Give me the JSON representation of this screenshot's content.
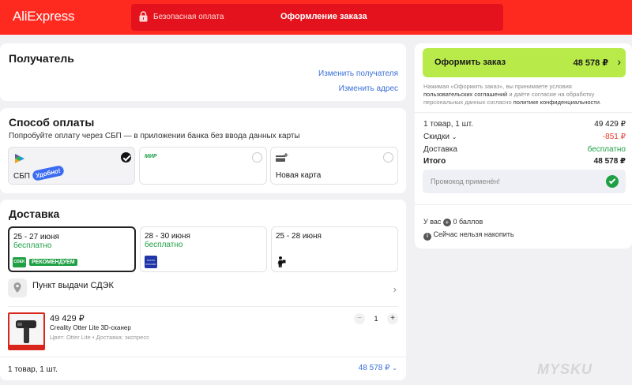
{
  "header": {
    "logo": "AliExpress",
    "secure_label": "Безопасная оплата",
    "page_title": "Оформление заказа",
    "brand_color": "#ff2a1f"
  },
  "recipient": {
    "title": "Получатель",
    "change_recipient": "Изменить получателя",
    "change_address": "Изменить адрес"
  },
  "payment": {
    "title": "Способ оплаты",
    "subtitle": "Попробуйте оплату через СБП — в приложении банка без ввода данных карты",
    "options": [
      {
        "label": "СБП",
        "badge": "Удобно!",
        "selected": true,
        "icon": "sbp-logo-icon"
      },
      {
        "label": "",
        "brand": "МИР",
        "selected": false,
        "icon": "mir-logo-icon"
      },
      {
        "label": "Новая карта",
        "selected": false,
        "icon": "add-card-icon"
      }
    ]
  },
  "delivery": {
    "title": "Доставка",
    "options": [
      {
        "date": "25 - 27 июня",
        "price": "бесплатно",
        "carrier": "CDEK",
        "badge": "РЕКОМЕНДУЕМ",
        "selected": true
      },
      {
        "date": "28 - 30 июня",
        "price": "бесплатно",
        "carrier": "ПОЧТА РОССИИ",
        "selected": false
      },
      {
        "date": "25 - 28 июня",
        "price": "",
        "carrier": "courier",
        "selected": false
      }
    ],
    "pickup_label": "Пункт выдачи СДЭК"
  },
  "product": {
    "price": "49 429 ₽",
    "name": "Creality Otter Lite 3D-сканер",
    "meta": "Цвет: Otter Lite • Доставка: экспресс",
    "quantity": "1",
    "minus": "−",
    "plus": "+"
  },
  "footer": {
    "count": "1 товар, 1 шт.",
    "total": "48 578 ₽"
  },
  "summary": {
    "order_button": "Оформить заказ",
    "order_total": "48 578 ₽",
    "legal_part1": "Нажимая «Оформить заказ», вы принимаете условия ",
    "legal_link1": "пользовательских соглашений",
    "legal_part2": " и даёте согласие на обработку персональных данных согласно ",
    "legal_link2": "политике конфиденциальности",
    "legal_end": ".",
    "items_label": "1 товар, 1 шт.",
    "items_value": "49 429 ₽",
    "discount_label": "Скидки",
    "discount_value": "-851 ₽",
    "shipping_label": "Доставка",
    "shipping_value": "бесплатно",
    "total_label": "Итого",
    "total_value": "48 578 ₽",
    "promo_text": "Промокод применён!",
    "bonus_prefix": "У вас",
    "bonus_value": "0 баллов",
    "bonus_note": "Сейчас нельзя накопить",
    "accent_green": "#b8ea4a",
    "discount_color": "#e8392a",
    "free_color": "#1fa045"
  },
  "watermark": "MYSKU"
}
